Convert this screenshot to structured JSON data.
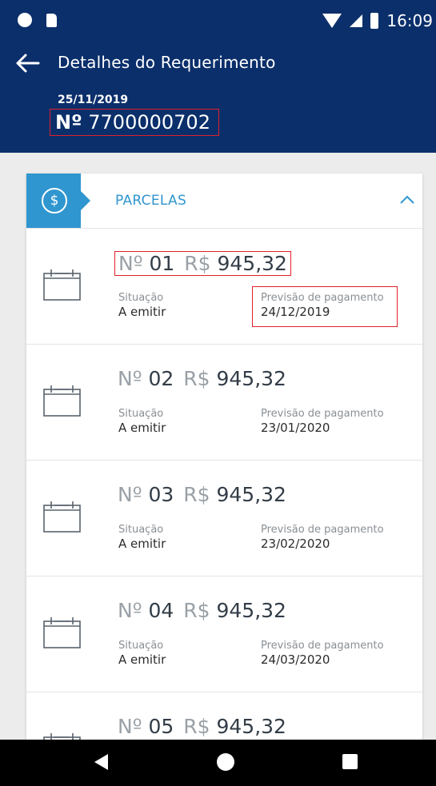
{
  "status_bar": {
    "time": "16:09"
  },
  "header": {
    "title": "Detalhes do Requerimento",
    "date": "25/11/2019",
    "number_prefix": "Nº",
    "number": "7700000702"
  },
  "card": {
    "title": "PARCELAS"
  },
  "parcelas": [
    {
      "num_label": "Nº",
      "num": "01",
      "currency": "R$",
      "amount": "945,32",
      "situacao_label": "Situação",
      "situacao": "A emitir",
      "previsao_label": "Previsão de pagamento",
      "previsao": "24/12/2019"
    },
    {
      "num_label": "Nº",
      "num": "02",
      "currency": "R$",
      "amount": "945,32",
      "situacao_label": "Situação",
      "situacao": "A emitir",
      "previsao_label": "Previsão de pagamento",
      "previsao": "23/01/2020"
    },
    {
      "num_label": "Nº",
      "num": "03",
      "currency": "R$",
      "amount": "945,32",
      "situacao_label": "Situação",
      "situacao": "A emitir",
      "previsao_label": "Previsão de pagamento",
      "previsao": "23/02/2020"
    },
    {
      "num_label": "Nº",
      "num": "04",
      "currency": "R$",
      "amount": "945,32",
      "situacao_label": "Situação",
      "situacao": "A emitir",
      "previsao_label": "Previsão de pagamento",
      "previsao": "24/03/2020"
    },
    {
      "num_label": "Nº",
      "num": "05",
      "currency": "R$",
      "amount": "945,32"
    }
  ],
  "colors": {
    "header_bg": "#0b2f6b",
    "accent": "#2f96cf",
    "highlight": "#e0202a"
  },
  "icons": {
    "back": "arrow-left-icon",
    "section": "dollar-circle-icon",
    "collapse": "chevron-up-icon",
    "parcela": "calendar-icon"
  }
}
